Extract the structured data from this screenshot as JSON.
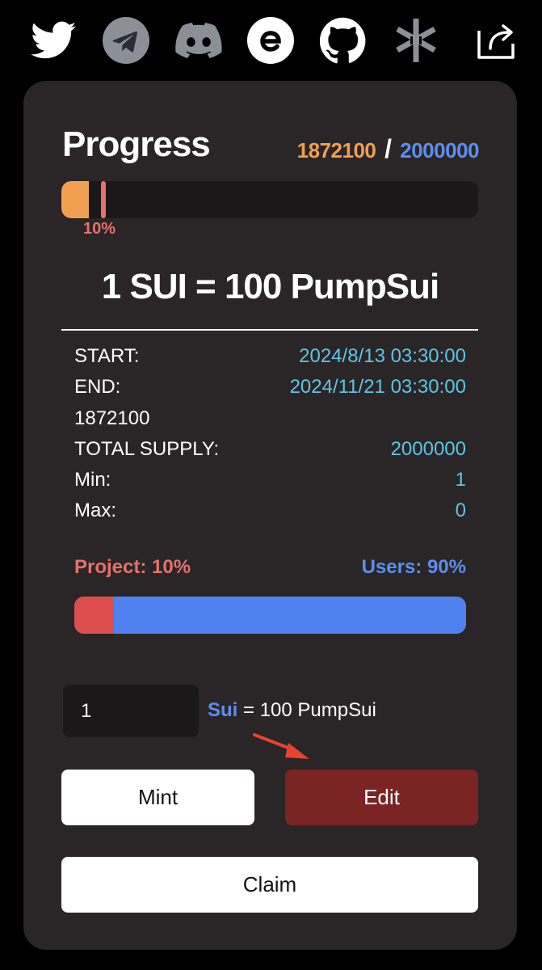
{
  "social": {
    "icons": [
      "twitter-icon",
      "telegram-icon",
      "discord-icon",
      "e-icon",
      "github-icon",
      "asterisk-icon",
      "share-icon"
    ]
  },
  "progress": {
    "title": "Progress",
    "current": "1872100",
    "separator": "/",
    "total": "2000000",
    "marker_label": "10%",
    "filled_fraction": 0.065,
    "marker_fraction": 0.1
  },
  "rate": "1 SUI = 100 PumpSui",
  "details": {
    "start_label": "START:",
    "start_value": "2024/8/13 03:30:00",
    "end_label": "END:",
    "end_value": "2024/11/21 03:30:00",
    "minted_value": "1872100",
    "total_supply_label": "TOTAL SUPPLY:",
    "total_supply_value": "2000000",
    "min_label": "Min:",
    "min_value": "1",
    "max_label": "Max:",
    "max_value": "0"
  },
  "split": {
    "project_label": "Project: 10%",
    "users_label": "Users: 90%",
    "project_fraction": 0.1
  },
  "mint_form": {
    "amount_value": "1",
    "unit": "Sui",
    "conversion_text": " = 100 PumpSui"
  },
  "buttons": {
    "mint": "Mint",
    "edit": "Edit",
    "claim": "Claim"
  },
  "colors": {
    "accent_orange": "#f0a050",
    "accent_blue": "#5b8ff0",
    "accent_red": "#e8706a",
    "value_cyan": "#5cc6e8",
    "edit_button": "#7a2424"
  }
}
